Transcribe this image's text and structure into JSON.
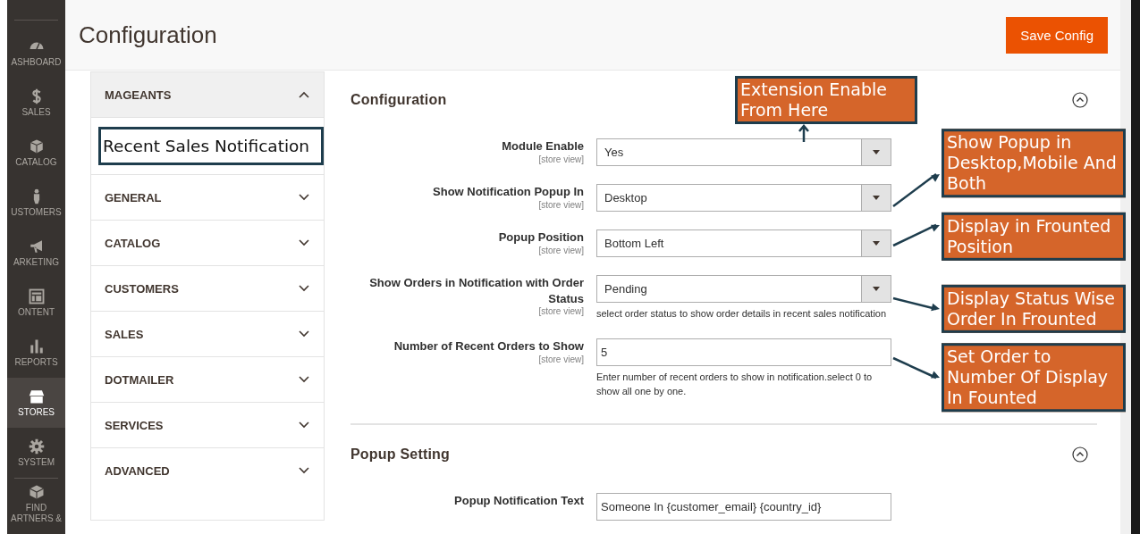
{
  "nav": {
    "items": [
      {
        "label": "ASHBOARD",
        "selected": false
      },
      {
        "label": "SALES",
        "selected": false
      },
      {
        "label": "CATALOG",
        "selected": false
      },
      {
        "label": "USTOMERS",
        "selected": false
      },
      {
        "label": "ARKETING",
        "selected": false
      },
      {
        "label": "ONTENT",
        "selected": false
      },
      {
        "label": "REPORTS",
        "selected": false
      },
      {
        "label": "STORES",
        "selected": true
      },
      {
        "label": "SYSTEM",
        "selected": false
      },
      {
        "label": "FIND ARTNERS &",
        "selected": false
      }
    ]
  },
  "page": {
    "title": "Configuration",
    "save_button": "Save Config"
  },
  "config_tabs": [
    {
      "label": "MAGEANTS",
      "expanded": true,
      "children": [
        {
          "label": "Recent Sales Notification",
          "selected": true
        }
      ]
    },
    {
      "label": "GENERAL",
      "expanded": false
    },
    {
      "label": "CATALOG",
      "expanded": false
    },
    {
      "label": "CUSTOMERS",
      "expanded": false
    },
    {
      "label": "SALES",
      "expanded": false
    },
    {
      "label": "DOTMAILER",
      "expanded": false
    },
    {
      "label": "SERVICES",
      "expanded": false
    },
    {
      "label": "ADVANCED",
      "expanded": false
    }
  ],
  "sections": [
    {
      "title": "Configuration",
      "expanded": true,
      "annotation": "Extension Enable From Here",
      "fields": [
        {
          "label": "Module Enable",
          "scope": "[store view]",
          "kind": "select",
          "value": "Yes"
        },
        {
          "label": "Show Notification Popup In",
          "scope": "[store view]",
          "kind": "select",
          "value": "Desktop",
          "annotation": "Show Popup in Desktop,Mobile And Both"
        },
        {
          "label": "Popup Position",
          "scope": "[store view]",
          "kind": "select",
          "value": "Bottom Left",
          "annotation": "Display in Frounted Position"
        },
        {
          "label": "Show Orders in Notification with Order Status",
          "scope": "[store view]",
          "kind": "select",
          "value": "Pending",
          "note": "select order status to show order details in recent sales notification",
          "annotation": "Display Status Wise Order In Frounted"
        },
        {
          "label": "Number of Recent Orders to Show",
          "scope": "[store view]",
          "kind": "text",
          "value": "5",
          "note": "Enter number of recent orders to show in notification.select 0 to show all one by one.",
          "annotation": "Set Order to Number Of Display In Founted"
        }
      ]
    },
    {
      "title": "Popup Setting",
      "expanded": true,
      "fields": [
        {
          "label": "Popup Notification Text",
          "kind": "text",
          "value": "Someone In {customer_email} {country_id}"
        }
      ]
    }
  ]
}
